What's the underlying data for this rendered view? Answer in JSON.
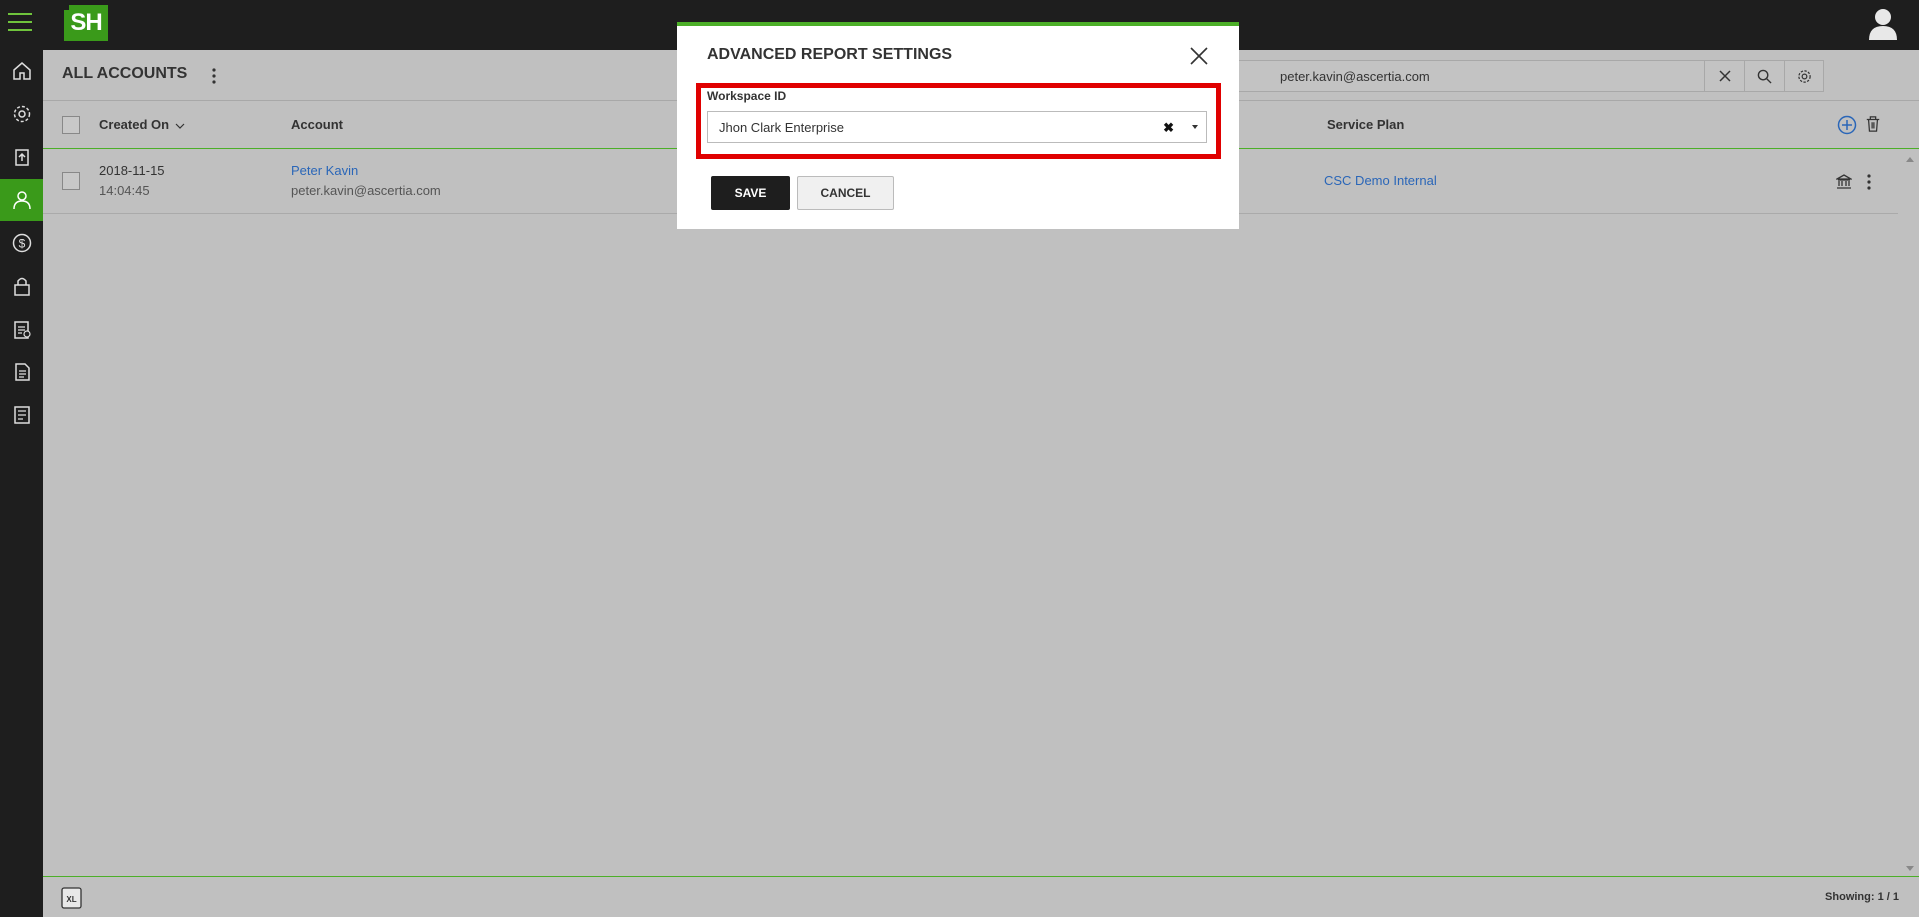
{
  "header": {
    "logo_text": "SH",
    "brand_color": "#3a9a1a",
    "accent_color": "#4caf28"
  },
  "sidebar": {
    "items": [
      {
        "icon": "home-icon",
        "active": false
      },
      {
        "icon": "gear-icon",
        "active": false
      },
      {
        "icon": "upload-icon",
        "active": false
      },
      {
        "icon": "user-icon",
        "active": true
      },
      {
        "icon": "dollar-icon",
        "active": false
      },
      {
        "icon": "lock-icon",
        "active": false
      },
      {
        "icon": "clipboard-icon",
        "active": false
      },
      {
        "icon": "document-icon",
        "active": false
      },
      {
        "icon": "report-icon",
        "active": false
      }
    ]
  },
  "page": {
    "title": "ALL ACCOUNTS",
    "search_value": "peter.kavin@ascertia.com"
  },
  "table": {
    "headers": {
      "created_on": "Created On",
      "account": "Account",
      "service_plan": "Service Plan"
    },
    "rows": [
      {
        "date": "2018-11-15",
        "time": "14:04:45",
        "name": "Peter Kavin",
        "email": "peter.kavin@ascertia.com",
        "service_plan": "CSC Demo Internal"
      }
    ]
  },
  "footer": {
    "excel_label": "XL",
    "showing": "Showing: 1 / 1"
  },
  "modal": {
    "title": "ADVANCED REPORT SETTINGS",
    "field_label": "Workspace ID",
    "field_value": "Jhon Clark Enterprise",
    "clear_glyph": "✖",
    "save_label": "SAVE",
    "cancel_label": "CANCEL"
  }
}
